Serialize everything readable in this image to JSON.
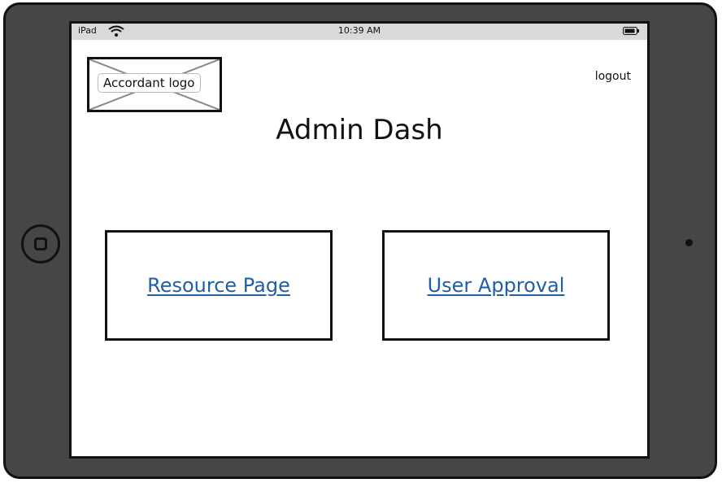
{
  "status_bar": {
    "carrier": "iPad",
    "time": "10:39 AM"
  },
  "header": {
    "logo_label": "Accordant logo",
    "logout_label": "logout",
    "title": "Admin Dash"
  },
  "cards": {
    "resource_label": "Resource Page",
    "approval_label": "User Approval"
  },
  "colors": {
    "link": "#1f5fa6",
    "device_frame": "#454648",
    "status_bar": "#d9d9d9"
  }
}
